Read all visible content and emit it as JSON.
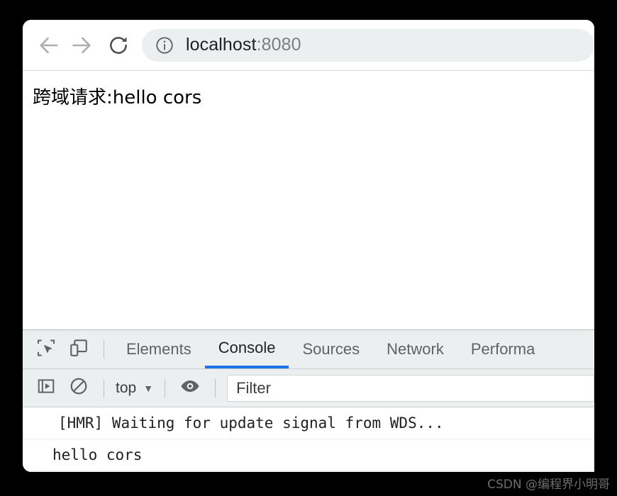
{
  "browser": {
    "toolbar": {
      "back_icon": "arrow-left-icon",
      "forward_icon": "arrow-right-icon",
      "reload_icon": "reload-icon",
      "site_info_icon": "info-circle-icon",
      "url_host": "localhost",
      "url_port": ":8080"
    },
    "page": {
      "body_text": "跨域请求:hello cors"
    }
  },
  "devtools": {
    "inspect_icon": "inspect-element-icon",
    "device_toolbar_icon": "device-toolbar-icon",
    "tabs": [
      {
        "label": "Elements",
        "active": false
      },
      {
        "label": "Console",
        "active": true
      },
      {
        "label": "Sources",
        "active": false
      },
      {
        "label": "Network",
        "active": false
      },
      {
        "label": "Performa",
        "active": false
      }
    ],
    "console_toolbar": {
      "sidebar_toggle_icon": "console-sidebar-toggle-icon",
      "clear_console_icon": "clear-console-icon",
      "context_label": "top",
      "context_caret": "▼",
      "live_expression_icon": "eye-icon",
      "filter_placeholder": "Filter"
    },
    "messages": [
      {
        "text": "[HMR] Waiting for update signal from WDS..."
      },
      {
        "text": "hello cors"
      }
    ]
  },
  "watermark": {
    "text": "CSDN @编程界小明哥"
  },
  "colors": {
    "accent_blue": "#1a73e8",
    "toolbar_bg": "#eceff0",
    "page_bg": "#ffffff",
    "backdrop": "#000000"
  }
}
